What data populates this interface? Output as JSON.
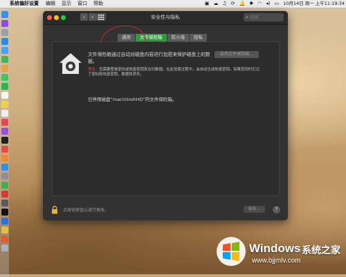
{
  "menubar": {
    "app_name": "系统偏好设置",
    "items": [
      "编辑",
      "显示",
      "窗口",
      "帮助"
    ],
    "clock": "10月14日 周一 上午11:19:34"
  },
  "window": {
    "title": "安全性与隐私",
    "search_placeholder": "搜索",
    "tabs": [
      {
        "label": "通用",
        "active": false
      },
      {
        "label": "文件保险箱",
        "active": true
      },
      {
        "label": "防火墙",
        "active": false
      },
      {
        "label": "隐私",
        "active": false
      }
    ]
  },
  "filevault": {
    "description": "文件保险箱通过自动对磁盘内容进行加密来保护磁盘上的数据。",
    "warning_label": "警告：",
    "warning_text": "您需要登录密码或恢复密钥来访问数据。在此设置过程中，会自动生成恢复密钥。如果您同时忘记了密码和恢复密钥，数据将丢失。",
    "turn_on_button": "启用文件保险箱…",
    "status": "已停用磁盘“macintoshHD”的文件保险箱。"
  },
  "footer": {
    "lock_text": "点按锁按钮以进行更改。",
    "advanced_button": "高级…",
    "help_label": "?"
  },
  "watermark": {
    "brand": "Windows",
    "cn": "系统之家",
    "url": "www.bjjmlv.com"
  },
  "colors": {
    "active_tab": "#2f9a3e",
    "annotation_circle": "#c82a2a"
  }
}
